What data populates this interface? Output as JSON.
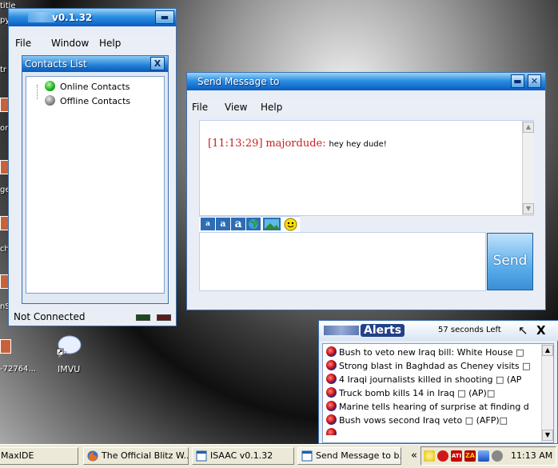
{
  "desktop": {
    "left_labels": [
      "title",
      "py",
      "tr",
      "on",
      "ge",
      "cho",
      "nSt",
      "-72764..."
    ],
    "imvu_label": "IMVU"
  },
  "isaac_window": {
    "title": "v0.1.32",
    "menu": [
      "File",
      "Window",
      "Help"
    ],
    "contacts_panel_title": "Contacts List",
    "groups": [
      {
        "label": "Online Contacts",
        "color": "#1fb51f"
      },
      {
        "label": "Offline Contacts",
        "color": "#8a8a8a"
      }
    ],
    "status_text": "Not Connected"
  },
  "message_window": {
    "title": "Send Message to",
    "menu": [
      "File",
      "View",
      "Help"
    ],
    "chat": {
      "timestamp": "[11:13:29]",
      "user": "majordude:",
      "text": "hey hey dude!"
    },
    "format_buttons": [
      "a",
      "a",
      "a"
    ],
    "send_label": "Send",
    "input_value": ""
  },
  "alerts": {
    "title": "Alerts",
    "time_ago": "57 seconds Left",
    "close_glyph": "X",
    "items": [
      "Bush to veto new Iraq bill: White House □",
      "Strong blast in Baghdad as Cheney visits □",
      "4 Iraqi journalists killed in shooting □    (AP",
      "Truck bomb kills 14 in Iraq □    (AP)□",
      "Marine tells hearing of surprise at finding d",
      "Bush vows second Iraq veto □    (AFP)□"
    ]
  },
  "taskbar": {
    "tasks": [
      "MaxIDE",
      "The Official Blitz W...",
      "ISAAC v0.1.32",
      "Send Message to b..."
    ],
    "tray_chevron": "«",
    "clock": "11:13 AM"
  }
}
